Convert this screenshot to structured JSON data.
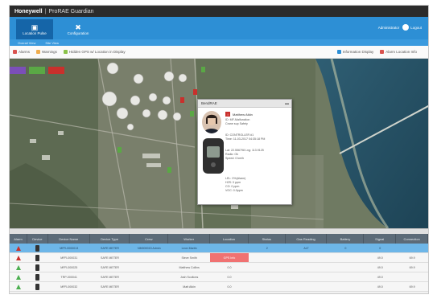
{
  "app": {
    "brand": "Honeywell",
    "product": "ProRAE Guardian"
  },
  "nav": {
    "tabs": [
      {
        "label": "Location Pulse",
        "icon": "monitor-icon",
        "active": true
      },
      {
        "label": "Configuration",
        "icon": "tools-icon",
        "active": false
      }
    ],
    "user": {
      "name": "Administrator",
      "logout_label": "Logout"
    }
  },
  "subtabs": [
    "Overall View",
    "Site View"
  ],
  "toolbar": {
    "items": [
      {
        "label": "Alarms",
        "color": "#d9534f"
      },
      {
        "label": "Warnings",
        "color": "#f0ad4e"
      },
      {
        "label": "Hidden GPS w/ Location in Display",
        "color": "#8bc34a"
      }
    ],
    "right": [
      {
        "label": "Information Display",
        "color": "#2d8fd5"
      },
      {
        "label": "Alarm Location Info",
        "color": "#d9534f"
      }
    ]
  },
  "map": {
    "legend": [
      {
        "color": "#7b4fb8"
      },
      {
        "color": "#5aa845"
      },
      {
        "color": "#c9302c"
      }
    ]
  },
  "popup": {
    "title": "BendRAE",
    "worker_name": "Matthew Atkin",
    "lines_top": [
      "ID: MF-Malfunction",
      "Crane sup Safety"
    ],
    "lines_mid": [
      "ID: CONTROLLER #1",
      "Time: 11-03-2017 04:35:18 PM"
    ],
    "lines_loc": [
      "Lat: 22.556798 Lng: 113.9125",
      "Radio: Ok",
      "Speed: 0 km/h"
    ],
    "lines_gas": [
      "LEL: 0%(Alarm)",
      "H2S: 0 ppm",
      "CO: 0 ppm",
      "VOC: 0.0ppm"
    ]
  },
  "table": {
    "headers": [
      "Alarm",
      "Device",
      "Device Name",
      "Device Type",
      "Crew",
      "Worker",
      "Location",
      "Status",
      "Gas Reading",
      "Battery",
      "Signal",
      "Connection"
    ],
    "rows": [
      {
        "alarm_color": "#c9302c",
        "cells": [
          "",
          "",
          "MFR-0000013",
          "SAFE METER",
          "NM000015 Admin",
          "Leon Martin",
          "",
          "2",
          "ALT",
          "0",
          "0",
          ""
        ],
        "selected": true,
        "highlight": -1
      },
      {
        "alarm_color": "#c9302c",
        "cells": [
          "",
          "",
          "MFR-000031",
          "SAFE METER",
          "",
          "Steve Smith",
          "GPS Info",
          "",
          "",
          "",
          "49.0",
          "69.9"
        ],
        "selected": false,
        "highlight": 6
      },
      {
        "alarm_color": "#4caf50",
        "cells": [
          "",
          "",
          "MFR-000025",
          "SAFE METER",
          "",
          "Matthew Collins",
          "0.0",
          "",
          "",
          "",
          "49.0",
          "69.9"
        ],
        "selected": false,
        "highlight": -1
      },
      {
        "alarm_color": "#4caf50",
        "cells": [
          "",
          "",
          "TRP-000041",
          "SAFE METER",
          "",
          "Josh Scoltons",
          "0.0",
          "",
          "",
          "",
          "49.0",
          ""
        ],
        "selected": false,
        "highlight": -1
      },
      {
        "alarm_color": "#4caf50",
        "cells": [
          "",
          "",
          "MFR-000032",
          "SAFE METER",
          "",
          "Matt Atkin",
          "0.0",
          "",
          "",
          "",
          "49.0",
          "69.9"
        ],
        "selected": false,
        "highlight": -1
      }
    ]
  }
}
